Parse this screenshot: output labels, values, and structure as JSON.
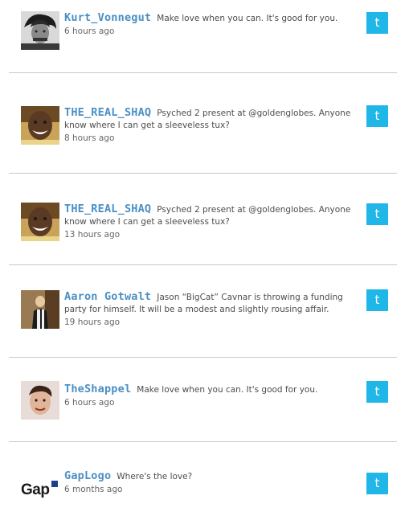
{
  "tweets": [
    {
      "username": "Kurt_Vonnegut",
      "text": "Make love when you can. It's good for you.",
      "time": "6 hours ago",
      "avatar_icon": "bw-portrait-avatar",
      "service_icon": "t"
    },
    {
      "username": "THE_REAL_SHAQ",
      "text": "Psyched 2 present at @goldenglobes. Anyone know where I can get a sleeveless tux?",
      "time": "8 hours ago",
      "avatar_icon": "smiling-man-avatar",
      "service_icon": "t"
    },
    {
      "username": "THE_REAL_SHAQ",
      "text": "Psyched 2 present at @goldenglobes. Anyone know where I can get a sleeveless tux?",
      "time": "13 hours ago",
      "avatar_icon": "smiling-man-avatar",
      "service_icon": "t"
    },
    {
      "username": "Aaron Gotwalt",
      "text": "Jason “BigCat” Cavnar is throwing a funding party for himself. It will be a modest and slightly rousing affair.",
      "time": "19 hours ago",
      "avatar_icon": "man-with-scarf-avatar",
      "service_icon": "t"
    },
    {
      "username": "TheShappel",
      "text": "Make love when you can. It's good for you.",
      "time": "6 hours ago",
      "avatar_icon": "man-portrait-avatar",
      "service_icon": "t"
    },
    {
      "username": "GapLogo",
      "text": "Where's the love?",
      "time": "6 months ago",
      "avatar_icon": "gap-logo-avatar",
      "avatar_text": "Gap",
      "service_icon": "t"
    }
  ],
  "colors": {
    "username": "#4a8fc4",
    "service_button": "#1fb6e8",
    "divider": "#c8c8c8",
    "text": "#4d4d4d"
  }
}
